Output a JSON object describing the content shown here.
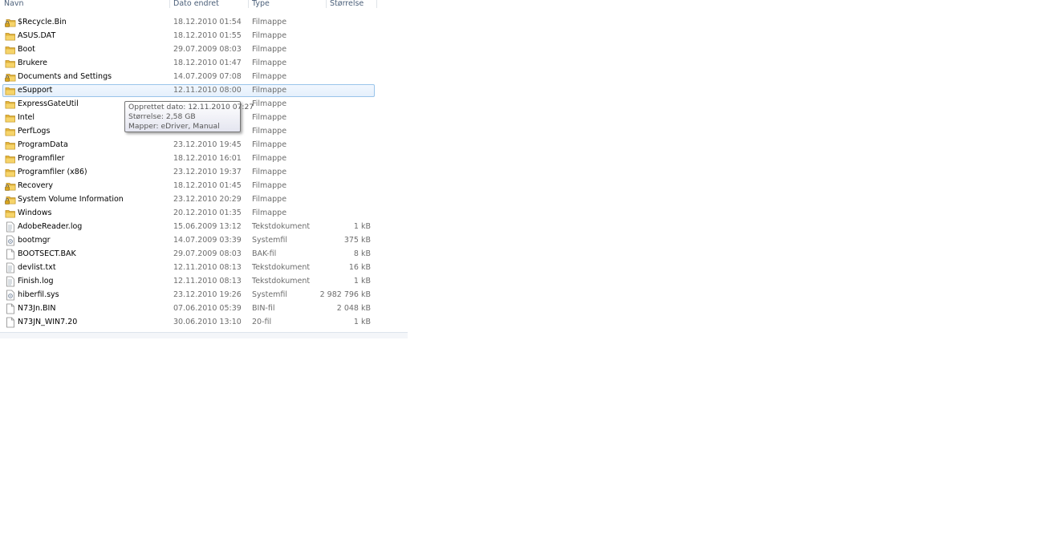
{
  "columns": {
    "name": "Navn",
    "date": "Dato endret",
    "type": "Type",
    "size": "Størrelse"
  },
  "colors": {
    "selection_border": "#99c4ea",
    "selection_fill": "#e5f0fc",
    "header_text": "#4c607a",
    "folder": "#e8b83d"
  },
  "files": [
    {
      "name": "$Recycle.Bin",
      "date": "18.12.2010 01:54",
      "type": "Filmappe",
      "size": "",
      "icon": "locked-folder-icon"
    },
    {
      "name": "ASUS.DAT",
      "date": "18.12.2010 01:55",
      "type": "Filmappe",
      "size": "",
      "icon": "folder-icon"
    },
    {
      "name": "Boot",
      "date": "29.07.2009 08:03",
      "type": "Filmappe",
      "size": "",
      "icon": "folder-icon"
    },
    {
      "name": "Brukere",
      "date": "18.12.2010 01:47",
      "type": "Filmappe",
      "size": "",
      "icon": "folder-icon"
    },
    {
      "name": "Documents and Settings",
      "date": "14.07.2009 07:08",
      "type": "Filmappe",
      "size": "",
      "icon": "locked-folder-icon"
    },
    {
      "name": "eSupport",
      "date": "12.11.2010 08:00",
      "type": "Filmappe",
      "size": "",
      "icon": "folder-icon",
      "selected": true
    },
    {
      "name": "ExpressGateUtil",
      "date": "",
      "type": "Filmappe",
      "size": "",
      "icon": "folder-icon"
    },
    {
      "name": "Intel",
      "date": "",
      "type": "Filmappe",
      "size": "",
      "icon": "folder-icon"
    },
    {
      "name": "PerfLogs",
      "date": "",
      "type": "Filmappe",
      "size": "",
      "icon": "folder-icon"
    },
    {
      "name": "ProgramData",
      "date": "23.12.2010 19:45",
      "type": "Filmappe",
      "size": "",
      "icon": "folder-icon"
    },
    {
      "name": "Programfiler",
      "date": "18.12.2010 16:01",
      "type": "Filmappe",
      "size": "",
      "icon": "folder-icon"
    },
    {
      "name": "Programfiler (x86)",
      "date": "23.12.2010 19:37",
      "type": "Filmappe",
      "size": "",
      "icon": "folder-icon"
    },
    {
      "name": "Recovery",
      "date": "18.12.2010 01:45",
      "type": "Filmappe",
      "size": "",
      "icon": "locked-folder-icon"
    },
    {
      "name": "System Volume Information",
      "date": "23.12.2010 20:29",
      "type": "Filmappe",
      "size": "",
      "icon": "locked-folder-icon"
    },
    {
      "name": "Windows",
      "date": "20.12.2010 01:35",
      "type": "Filmappe",
      "size": "",
      "icon": "folder-icon"
    },
    {
      "name": "AdobeReader.log",
      "date": "15.06.2009 13:12",
      "type": "Tekstdokument",
      "size": "1 kB",
      "icon": "text-file-icon"
    },
    {
      "name": "bootmgr",
      "date": "14.07.2009 03:39",
      "type": "Systemfil",
      "size": "375 kB",
      "icon": "system-file-icon"
    },
    {
      "name": "BOOTSECT.BAK",
      "date": "29.07.2009 08:03",
      "type": "BAK-fil",
      "size": "8 kB",
      "icon": "file-icon"
    },
    {
      "name": "devlist.txt",
      "date": "12.11.2010 08:13",
      "type": "Tekstdokument",
      "size": "16 kB",
      "icon": "text-file-icon"
    },
    {
      "name": "Finish.log",
      "date": "12.11.2010 08:13",
      "type": "Tekstdokument",
      "size": "1 kB",
      "icon": "text-file-icon"
    },
    {
      "name": "hiberfil.sys",
      "date": "23.12.2010 19:26",
      "type": "Systemfil",
      "size": "2 982 796 kB",
      "icon": "system-file-icon"
    },
    {
      "name": "N73Jn.BIN",
      "date": "07.06.2010 05:39",
      "type": "BIN-fil",
      "size": "2 048 kB",
      "icon": "file-icon"
    },
    {
      "name": "N73JN_WIN7.20",
      "date": "30.06.2010 13:10",
      "type": "20-fil",
      "size": "1 kB",
      "icon": "file-icon"
    }
  ],
  "tooltip": {
    "line1": "Opprettet dato: 12.11.2010 07:27",
    "line2": "Størrelse: 2,58 GB",
    "line3": "Mapper: eDriver, Manual"
  }
}
